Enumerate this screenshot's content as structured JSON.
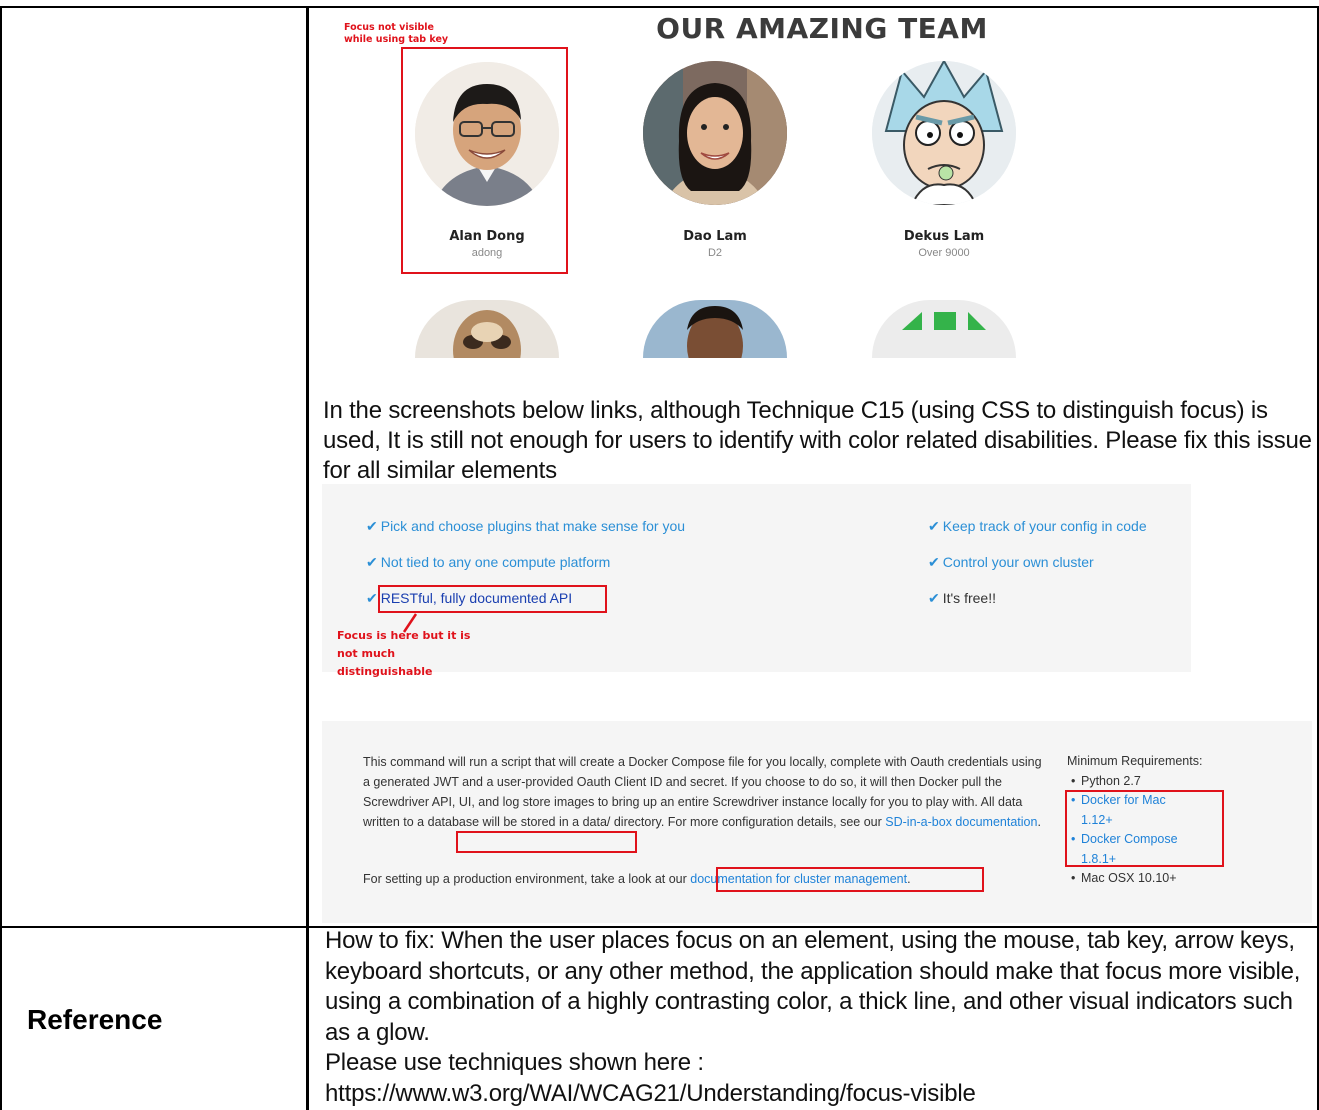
{
  "team": {
    "title": "OUR AMAZING TEAM",
    "focus_note": "Focus not visible while using tab key",
    "members": [
      {
        "name": "Alan Dong",
        "handle": "adong"
      },
      {
        "name": "Dao Lam",
        "handle": "D2"
      },
      {
        "name": "Dekus Lam",
        "handle": "Over 9000"
      }
    ]
  },
  "paragraph": "In the screenshots below links, although Technique C15 (using CSS to distinguish focus) is used, It is still not enough for users to identify with color related disabilities. Please fix this issue for all similar elements",
  "features": {
    "left": [
      "Pick and choose plugins that make sense for you",
      "Not tied to any one compute platform",
      "RESTful, fully documented API"
    ],
    "right": [
      "Keep track of your config in code",
      "Control your own cluster",
      "It's free!!"
    ],
    "focus_note": "Focus is here but it is not much distinguishable"
  },
  "docker": {
    "text_before_link": "This command will run a script that will create a Docker Compose file for you locally, complete with Oauth credentials using a generated JWT and a user-provided Oauth Client ID and secret. If you choose to do so, it will then Docker pull the Screwdriver API, UI, and log store images to bring up an entire Screwdriver instance locally for you to play with. All data written to a database will be stored in a data/ directory. For more configuration details, see our ",
    "link1": "SD-in-a-box documentation",
    "after_link1": ".",
    "text2": "For setting up a production environment, take a look at our ",
    "link2": "documentation for cluster management",
    "after_link2": ".",
    "req_title": "Minimum Requirements:",
    "requirements": [
      "Python 2.7",
      "Docker for Mac 1.12+",
      "Docker Compose 1.8.1+",
      "Mac OSX 10.10+"
    ]
  },
  "reference": {
    "label": "Reference",
    "howto": "How to fix: When the user places focus on an element, using the mouse, tab key, arrow keys, keyboard shortcuts, or any other method, the application should make that focus more visible, using a combination of a highly contrasting color, a thick line, and other visual indicators such as a glow.",
    "use_techniques": "Please use techniques shown here :",
    "url": "https://www.w3.org/WAI/WCAG21/Understanding/focus-visible"
  },
  "colors": {
    "accent_red": "#e0121b",
    "link_blue": "#1f82d8",
    "panel_bg": "#f5f5f5"
  }
}
